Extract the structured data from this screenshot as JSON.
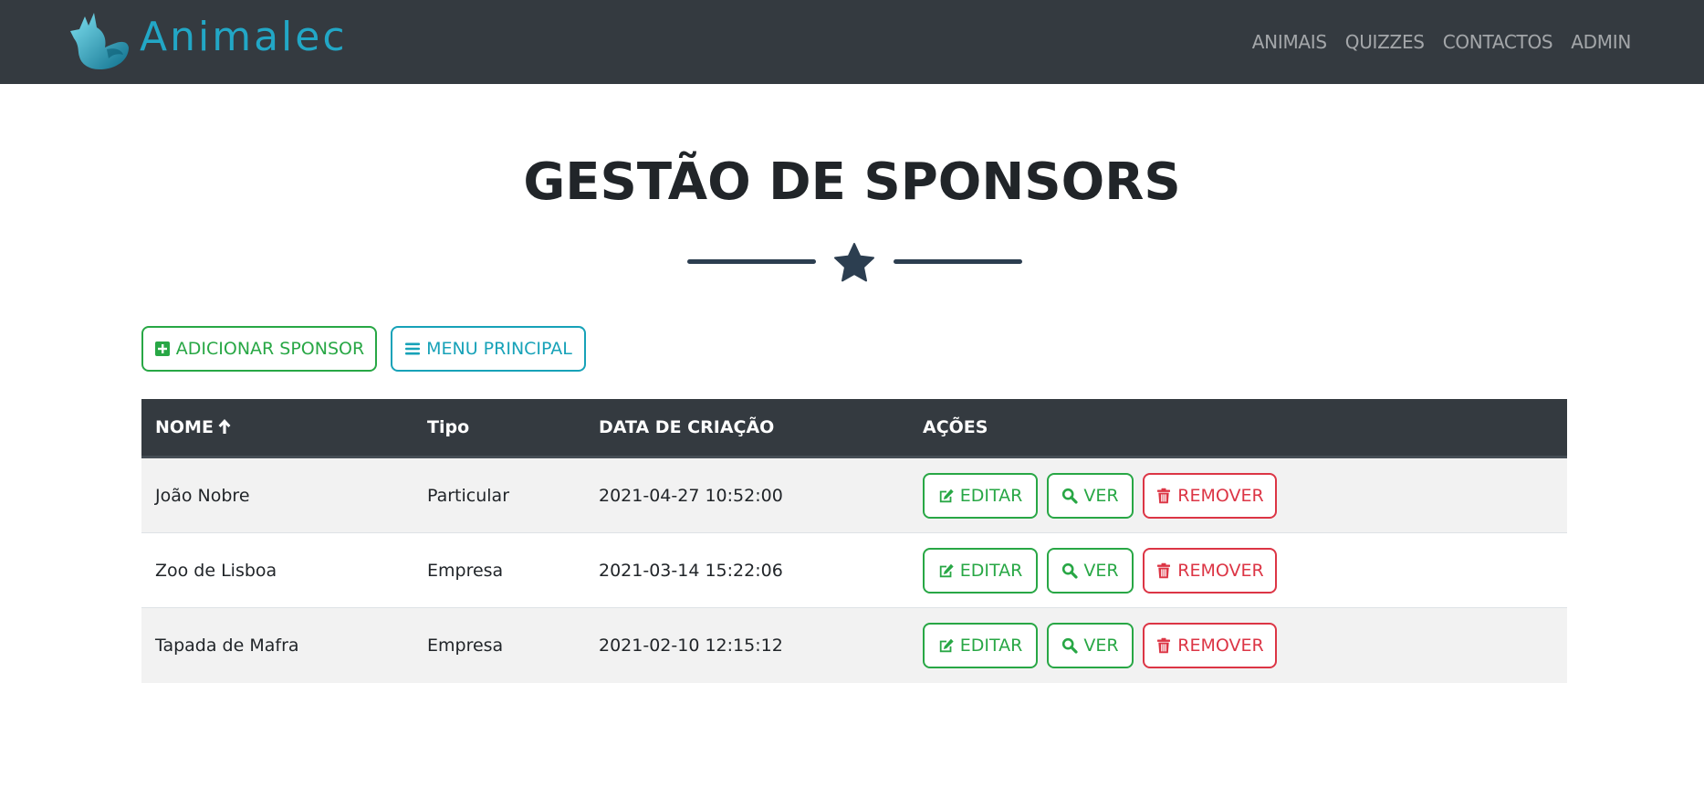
{
  "navbar": {
    "brand_name": "Animalec",
    "links": [
      "ANIMAIS",
      "QUIZZES",
      "CONTACTOS",
      "ADMIN"
    ]
  },
  "page": {
    "title": "GESTÃO DE SPONSORS"
  },
  "actions": {
    "add_label": "ADICIONAR SPONSOR",
    "menu_label": "MENU PRINCIPAL"
  },
  "table": {
    "headers": {
      "name": "NOME",
      "type": "Tipo",
      "created": "DATA DE CRIAÇÃO",
      "actions": "AÇÕES"
    },
    "sort": {
      "column": "name",
      "direction": "asc",
      "icon": "arrow-up-icon"
    },
    "rows": [
      {
        "name": "João Nobre",
        "type": "Particular",
        "created": "2021-04-27 10:52:00"
      },
      {
        "name": "Zoo de Lisboa",
        "type": "Empresa",
        "created": "2021-03-14 15:22:06"
      },
      {
        "name": "Tapada de Mafra",
        "type": "Empresa",
        "created": "2021-02-10 12:15:12"
      }
    ],
    "row_buttons": {
      "edit_label": "EDITAR",
      "view_label": "VER",
      "remove_label": "REMOVER"
    }
  },
  "icons": {
    "brand": "fox-logo-icon",
    "divider": "star-icon",
    "add": "plus-square-icon",
    "menu": "bars-icon",
    "edit": "edit-icon",
    "view": "search-icon",
    "remove": "trash-icon"
  },
  "colors": {
    "navbar_bg": "#343a40",
    "brand": "#22a7c6",
    "success": "#28a745",
    "info": "#17a2b8",
    "danger": "#dc3545",
    "divider": "#2c3e50"
  }
}
